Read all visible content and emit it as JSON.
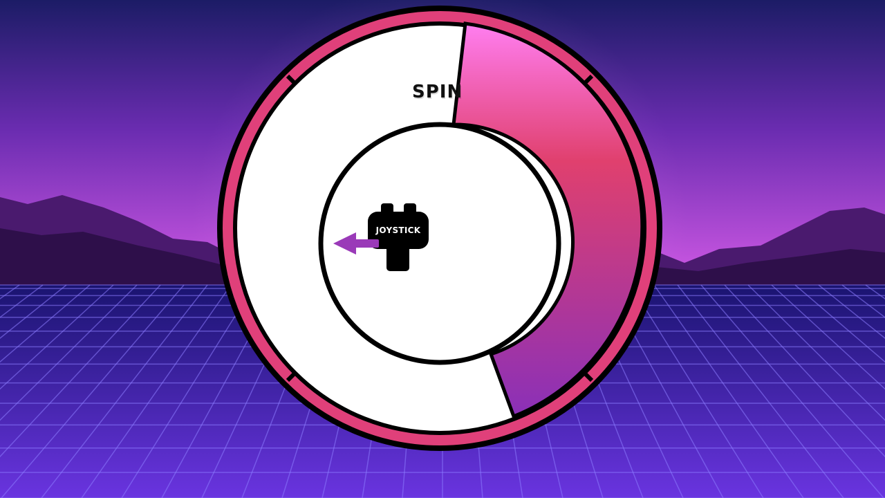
{
  "game": {
    "wheel_label": "SPIN",
    "joystick_label": "JOYSTICK"
  },
  "colors": {
    "sky_top": "#1c1c66",
    "sky_mid": "#6a2cb0",
    "horizon_glow": "#d25ae6",
    "mountain": "#4a1a6e",
    "grid_floor": "#3a22b8",
    "grid_line": "#8c7cff",
    "ring_outer": "#e0407a",
    "ring_stroke": "#000000",
    "wedge_top": "#ff7ef0",
    "wedge_mid": "#e0406e",
    "wedge_bottom": "#8a30b8",
    "arrow": "#9a3ab8"
  },
  "icons": [
    "joystick-icon",
    "arrow-left-icon"
  ]
}
